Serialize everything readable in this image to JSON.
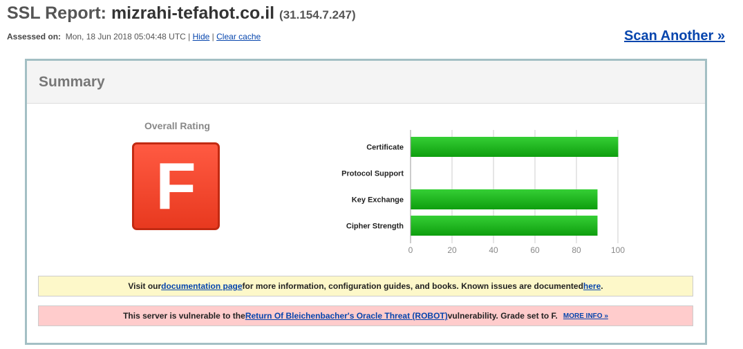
{
  "header": {
    "title_label": "SSL Report:",
    "hostname": "mizrahi-tefahot.co.il",
    "ip": "(31.154.7.247)",
    "assessed_label": "Assessed on:",
    "assessed_date": "Mon, 18 Jun 2018 05:04:48 UTC",
    "separator": "|",
    "hide_link": "Hide",
    "clear_cache_link": "Clear cache",
    "scan_another": "Scan Another »"
  },
  "summary": {
    "title": "Summary",
    "overall_rating_label": "Overall Rating",
    "grade": "F",
    "grade_color": "#ef4a30"
  },
  "chart_data": {
    "type": "bar",
    "orientation": "horizontal",
    "categories": [
      "Certificate",
      "Protocol Support",
      "Key Exchange",
      "Cipher Strength"
    ],
    "values": [
      100,
      0,
      90,
      90
    ],
    "xlim": [
      0,
      100
    ],
    "ticks": [
      0,
      20,
      40,
      60,
      80,
      100
    ],
    "grid": true,
    "bar_color": "#1fb21f"
  },
  "notices": {
    "docs": {
      "before": "Visit our ",
      "link1": "documentation page",
      "middle": " for more information, configuration guides, and books. Known issues are documented ",
      "link2": "here",
      "after": "."
    },
    "robot": {
      "before": "This server is vulnerable to the ",
      "link": "Return Of Bleichenbacher's Oracle Threat (ROBOT)",
      "after": " vulnerability. Grade set to F.",
      "more_info": "MORE INFO »"
    }
  }
}
